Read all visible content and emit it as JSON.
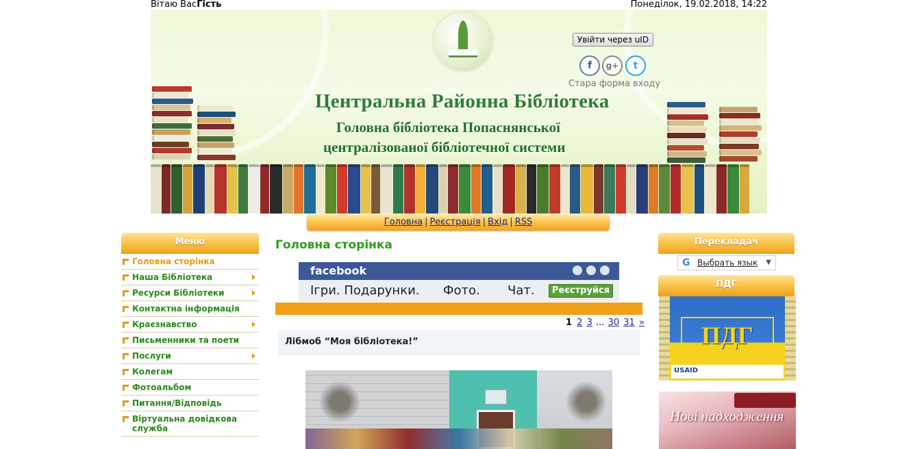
{
  "topbar": {
    "greeting_prefix": "Вітаю Вас",
    "user": "Гість",
    "datetime": "Понеділок, 19.02.2018, 14:22"
  },
  "header": {
    "login_button": "Увійти через uID",
    "old_login": "Стара форма входу",
    "site_title": "Центральна Районна Бібліотека",
    "subtitle_line1": "Головна бібліотека Попаснянської",
    "subtitle_line2": "централізованої бібліотечної системи",
    "social": [
      {
        "icon": "facebook-icon",
        "glyph": "f"
      },
      {
        "icon": "google-plus-icon",
        "glyph": "g+"
      },
      {
        "icon": "twitter-icon",
        "glyph": "t"
      }
    ]
  },
  "nav": {
    "home": "Головна",
    "register": "Реєстрація",
    "login": "Вхід",
    "rss": "RSS",
    "separator": "|"
  },
  "menu": {
    "title": "Меню",
    "items": [
      {
        "label": "Головна сторінка",
        "active": true,
        "submenu": false
      },
      {
        "label": "Наша Бібліотека",
        "active": false,
        "submenu": true
      },
      {
        "label": "Ресурси Бібліотеки",
        "active": false,
        "submenu": true
      },
      {
        "label": "Контактна інформація",
        "active": false,
        "submenu": false
      },
      {
        "label": "Краєзнавство",
        "active": false,
        "submenu": true
      },
      {
        "label": "Письменники та поети",
        "active": false,
        "submenu": false
      },
      {
        "label": "Послуги",
        "active": false,
        "submenu": true
      },
      {
        "label": "Колегам",
        "active": false,
        "submenu": false
      },
      {
        "label": "Фотоальбом",
        "active": false,
        "submenu": false
      },
      {
        "label": "Питання/Відповідь",
        "active": false,
        "submenu": false
      },
      {
        "label": "Віртуальна довідкова служба",
        "active": false,
        "submenu": false
      }
    ]
  },
  "main": {
    "page_title": "Головна сторінка",
    "ad": {
      "brand": "facebook",
      "text1": "Ігри. Подарунки.",
      "text2": "Фото.",
      "text3": "Чат.",
      "button": "Реєструйся"
    },
    "pager": {
      "current": "1",
      "pages": [
        "2",
        "3"
      ],
      "ellipsis": "...",
      "tail": [
        "30",
        "31"
      ],
      "next": "»"
    },
    "post_title": "Лібмоб “Моя бібліотека!”"
  },
  "right": {
    "translator_title": "Перекладач",
    "translator_logo": "G",
    "translator_link": "Выбрать язык",
    "translator_dropdown": "▼",
    "pdg_title": "ПДГ",
    "pdg_banner": "ПДГ",
    "pdg_logo": "USAID",
    "new_books": "Нові надходження"
  },
  "colors": {
    "accent_orange": "#f0a01a",
    "menu_green": "#2a8a1a",
    "link_blue": "#1a2a8a",
    "facebook_blue": "#3b5998"
  }
}
